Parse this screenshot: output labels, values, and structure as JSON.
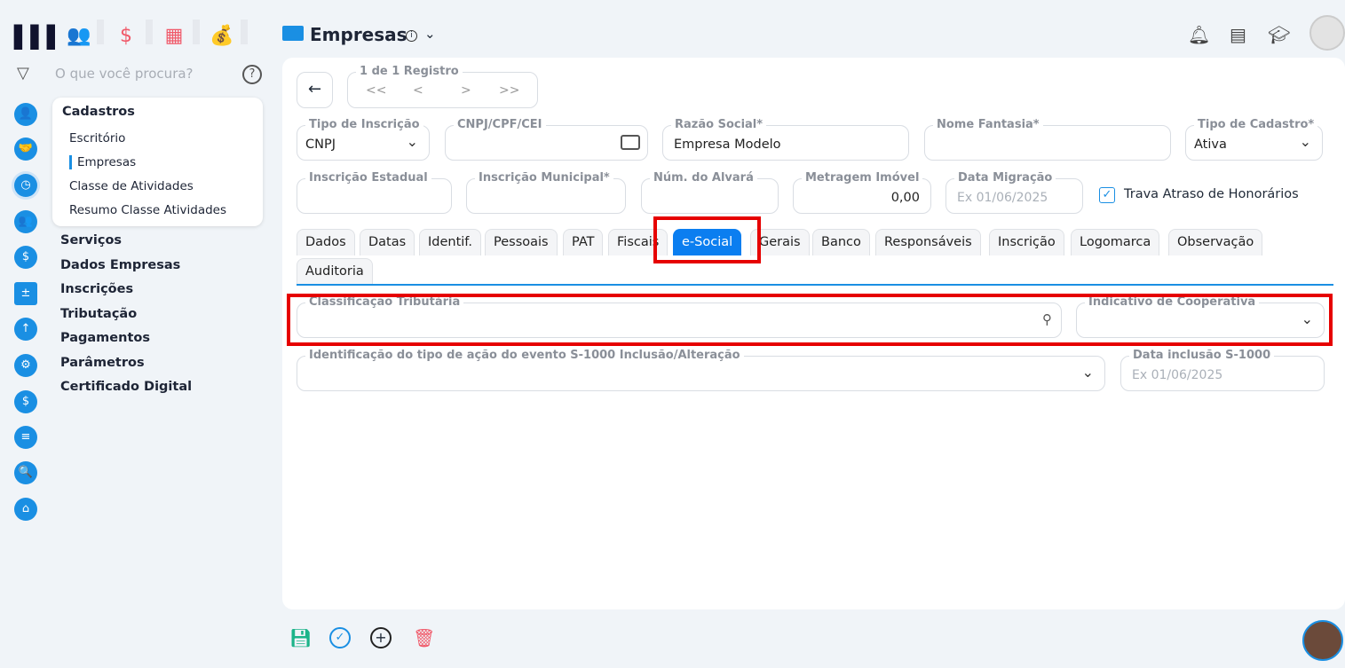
{
  "header": {
    "title": "Empresas"
  },
  "search": {
    "placeholder": "O que você procura?"
  },
  "sidebar": {
    "group": "Cadastros",
    "sub_items": [
      "Escritório",
      "Empresas",
      "Classe de Atividades",
      "Resumo Classe Atividades"
    ],
    "items": [
      "Serviços",
      "Dados Empresas",
      "Inscrições",
      "Tributação",
      "Pagamentos",
      "Parâmetros",
      "Certificado Digital"
    ]
  },
  "nav": {
    "registro": "1 de 1 Registro",
    "first": "<<",
    "prev": "<",
    "next": ">",
    "last": ">>"
  },
  "form": {
    "tipo_inscricao": {
      "label": "Tipo de Inscrição",
      "value": "CNPJ"
    },
    "cnpj": {
      "label": "CNPJ/CPF/CEI",
      "value": ""
    },
    "razao_social": {
      "label": "Razão Social*",
      "value": "Empresa Modelo"
    },
    "nome_fantasia": {
      "label": "Nome Fantasia*",
      "value": ""
    },
    "tipo_cadastro": {
      "label": "Tipo de Cadastro*",
      "value": "Ativa"
    },
    "inscricao_estadual": {
      "label": "Inscrição Estadual"
    },
    "inscricao_municipal": {
      "label": "Inscrição Municipal*"
    },
    "alvara": {
      "label": "Núm. do Alvará"
    },
    "metragem": {
      "label": "Metragem Imóvel",
      "value": "0,00"
    },
    "data_migracao": {
      "label": "Data Migração",
      "placeholder": "Ex 01/06/2025"
    },
    "trava": {
      "label": "Trava Atraso de Honorários",
      "checked": true
    }
  },
  "tabs": [
    "Dados",
    "Datas",
    "Identif.",
    "Pessoais",
    "PAT",
    "Fiscais",
    "e-Social",
    "Gerais",
    "Banco",
    "Responsáveis",
    "Inscrição",
    "Logomarca",
    "Observação",
    "Auditoria"
  ],
  "esocial": {
    "classificacao": {
      "label": "Classificação Tributária"
    },
    "cooperativa": {
      "label": "Indicativo de Cooperativa"
    },
    "acao_s1000": {
      "label": "Identificação do tipo de ação do evento S-1000 Inclusão/Alteração"
    },
    "data_s1000": {
      "label": "Data inclusão S-1000",
      "placeholder": "Ex 01/06/2025"
    }
  }
}
